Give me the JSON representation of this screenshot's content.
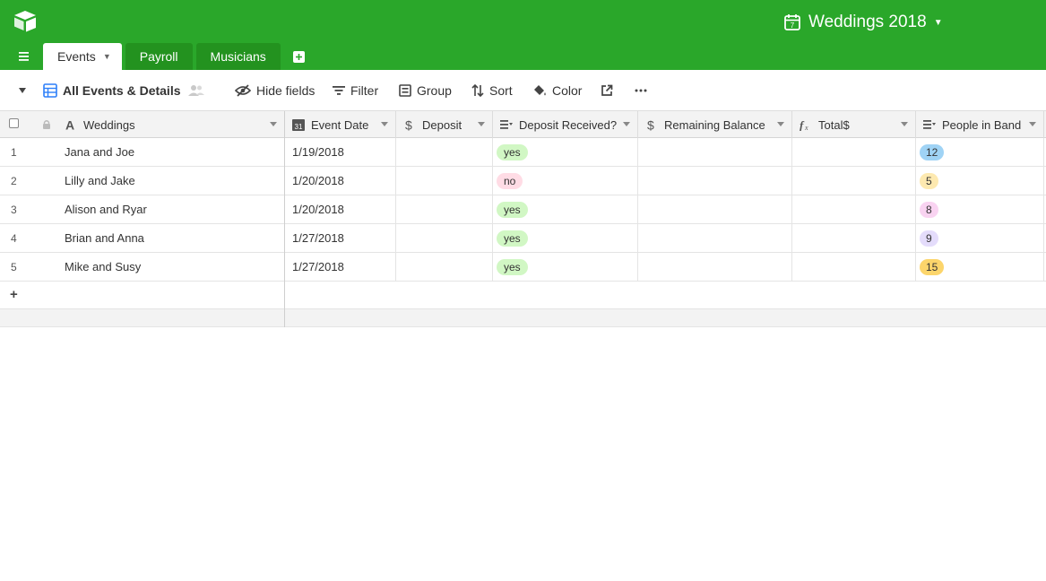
{
  "header": {
    "base_title": "Weddings 2018",
    "bg_color": "#2aa72a",
    "tabs": [
      {
        "label": "Events",
        "active": true
      },
      {
        "label": "Payroll",
        "active": false
      },
      {
        "label": "Musicians",
        "active": false
      }
    ]
  },
  "toolbar": {
    "view_name": "All Events & Details",
    "hide_fields": "Hide fields",
    "filter": "Filter",
    "group": "Group",
    "sort": "Sort",
    "color": "Color"
  },
  "columns": [
    {
      "label": "Weddings",
      "icon": "text-icon"
    },
    {
      "label": "Event Date",
      "icon": "calendar-icon"
    },
    {
      "label": "Deposit",
      "icon": "currency-icon"
    },
    {
      "label": "Deposit Received?",
      "icon": "single-select-icon"
    },
    {
      "label": "Remaining Balance",
      "icon": "currency-icon"
    },
    {
      "label": "Total$",
      "icon": "formula-icon"
    },
    {
      "label": "People in Band",
      "icon": "single-select-icon"
    }
  ],
  "rows": [
    {
      "num": "1",
      "wedding": "Jana and Joe",
      "date": "1/19/2018",
      "received": "yes",
      "band": "12",
      "band_color": "#9fd3f5"
    },
    {
      "num": "2",
      "wedding": "Lilly and Jake",
      "date": "1/20/2018",
      "received": "no",
      "band": "5",
      "band_color": "#fde9b0"
    },
    {
      "num": "3",
      "wedding": "Alison and Ryar",
      "date": "1/20/2018",
      "received": "yes",
      "band": "8",
      "band_color": "#f9d3f1"
    },
    {
      "num": "4",
      "wedding": "Brian and Anna",
      "date": "1/27/2018",
      "received": "yes",
      "band": "9",
      "band_color": "#e4dcfb"
    },
    {
      "num": "5",
      "wedding": "Mike and Susy",
      "date": "1/27/2018",
      "received": "yes",
      "band": "15",
      "band_color": "#fcd56b"
    }
  ],
  "add_row": "+"
}
